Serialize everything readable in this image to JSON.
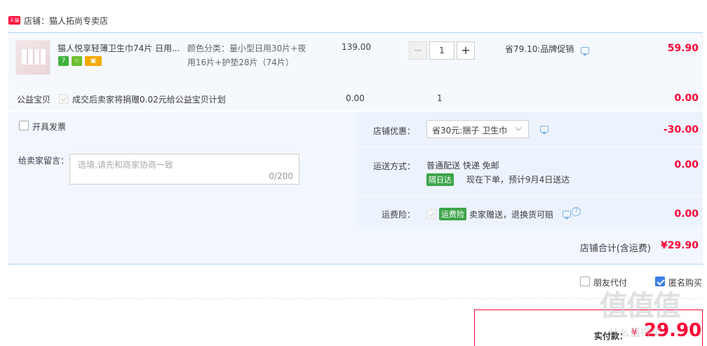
{
  "shop": {
    "logo_text": "天猫",
    "label": "店铺：猫人拓尚专卖店"
  },
  "item": {
    "title": "猫人悦享轻薄卫生巾74片 日用...",
    "badges": [
      "7",
      "☆",
      "▣"
    ],
    "sku_label": "颜色分类：",
    "sku_value_line1": "量小型日用30片+夜",
    "sku_value_line2": "用16片+护垫28片（74片）",
    "unit_price": "139.00",
    "quantity": "1",
    "minus_label": "−",
    "plus_label": "+",
    "promo": "省79.10:品牌促销",
    "subtotal": "59.90"
  },
  "charity": {
    "label": "公益宝贝",
    "text": "成交后卖家将捐赠0.02元给公益宝贝计划",
    "price": "0.00",
    "qty": "1",
    "subtotal": "0.00"
  },
  "invoice": {
    "label": "开具发票"
  },
  "message": {
    "label": "给卖家留言：",
    "placeholder": "选填,请先和商家协商一致",
    "counter": "0/200"
  },
  "shop_discount": {
    "label": "店铺优惠：",
    "selected": "省30元:捆子 卫生巾",
    "amount": "-30.00"
  },
  "shipping": {
    "label": "运送方式：",
    "method": "普通配送 快递 免邮",
    "tag": "隔日达",
    "eta": "现在下单，预计9月4日送达",
    "amount": "0.00"
  },
  "insurance": {
    "label": "运费险：",
    "tag": "运费险",
    "text": "卖家赠送，退换货可赔",
    "amount": "0.00"
  },
  "shop_total": {
    "label": "店铺合计(含运费)",
    "amount": "¥29.90"
  },
  "options": {
    "friend_pay": "朋友代付",
    "anonymous": "匿名购买"
  },
  "pay": {
    "label": "实付款：",
    "amount": "29.90",
    "currency": "¥"
  },
  "watermark": {
    "text": "值值值",
    "sub": "什么值得买"
  }
}
